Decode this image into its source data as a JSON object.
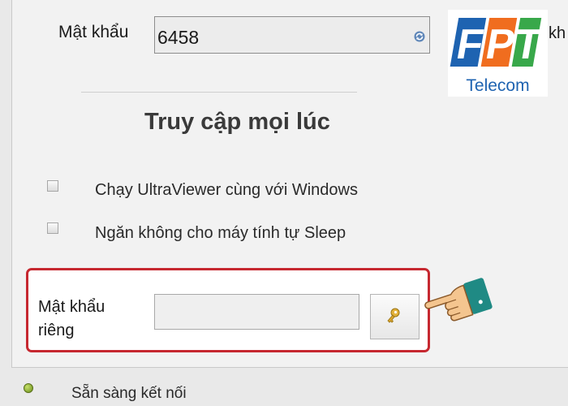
{
  "password": {
    "label": "Mật khẩu",
    "value": "6458",
    "refresh_icon": "refresh-icon"
  },
  "section_title": "Truy cập mọi lúc",
  "options": [
    {
      "label": "Chạy UltraViewer cùng với Windows",
      "checked": false
    },
    {
      "label": "Ngăn không cho máy tính tự Sleep",
      "checked": false
    }
  ],
  "private_password": {
    "label": "Mật khẩu riêng",
    "value": "",
    "button_icon": "key-icon"
  },
  "status": {
    "text": "Sẵn sàng kết nối",
    "indicator_color": "#7ca321"
  },
  "logo": {
    "letters": "FPT",
    "word": "Telecom"
  },
  "stray_text": "kh",
  "colors": {
    "highlight_border": "#c62830",
    "logo_blue": "#1e63b1",
    "logo_orange": "#f06d1f",
    "logo_green": "#38a84a"
  }
}
